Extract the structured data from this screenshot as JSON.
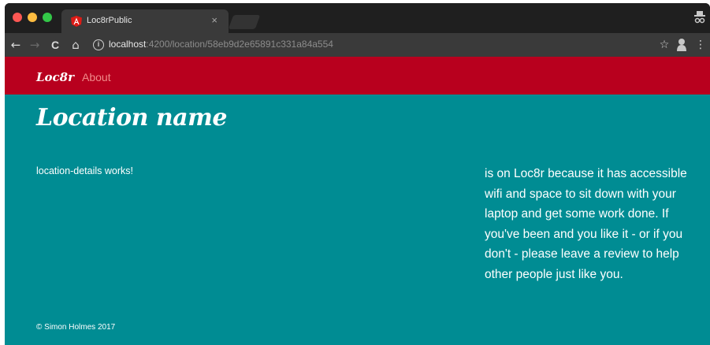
{
  "browser": {
    "tab": {
      "title": "Loc8rPublic",
      "close_glyph": "×",
      "favicon": "angular-icon",
      "favicon_color": "#dd1b16"
    },
    "toolbar": {
      "back_glyph": "←",
      "forward_glyph": "→",
      "reload_glyph": "C",
      "home_glyph": "⌂",
      "info_glyph": "i",
      "url_host": "localhost",
      "url_path": ":4200/location/58eb9d2e65891c331a84a554",
      "star_glyph": "☆",
      "menu_glyph": "⋮"
    }
  },
  "navbar": {
    "brand": "Loc8r",
    "links": [
      {
        "label": "About"
      }
    ],
    "background_color": "#b8001e"
  },
  "main": {
    "page_title": "Location name",
    "details_text": "location-details works!",
    "sidebar_text": "is on Loc8r because it has accessible wifi and space to sit down with your laptop and get some work done. If you've been and you like it - or if you don't - please leave a review to help other people just like you.",
    "background_color": "#008c93"
  },
  "footer": {
    "text": "© Simon Holmes 2017"
  }
}
